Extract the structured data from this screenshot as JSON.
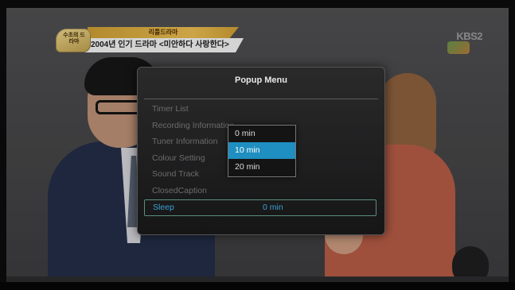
{
  "broadcast": {
    "badge": "수초의\n드라마",
    "caption_top": "리틀드라마",
    "caption_main": "2004년 인기 드라마 <미안하다 사랑한다>",
    "channel_logo": "KBS2"
  },
  "popup": {
    "title": "Popup Menu",
    "items": [
      {
        "label": "Timer List"
      },
      {
        "label": "Recording Information"
      },
      {
        "label": "Tuner Information"
      },
      {
        "label": "Colour Setting"
      },
      {
        "label": "Sound Track"
      },
      {
        "label": "ClosedCaption"
      },
      {
        "label": "Sleep",
        "value": "0 min",
        "selected": true
      }
    ]
  },
  "sleep_dropdown": {
    "options": [
      "0 min",
      "10 min",
      "20 min"
    ],
    "highlighted": "10 min"
  },
  "colors": {
    "highlight": "#1f8ec0",
    "selected_text": "#3aa0d4",
    "dimmed_text": "#6c6c6c"
  }
}
